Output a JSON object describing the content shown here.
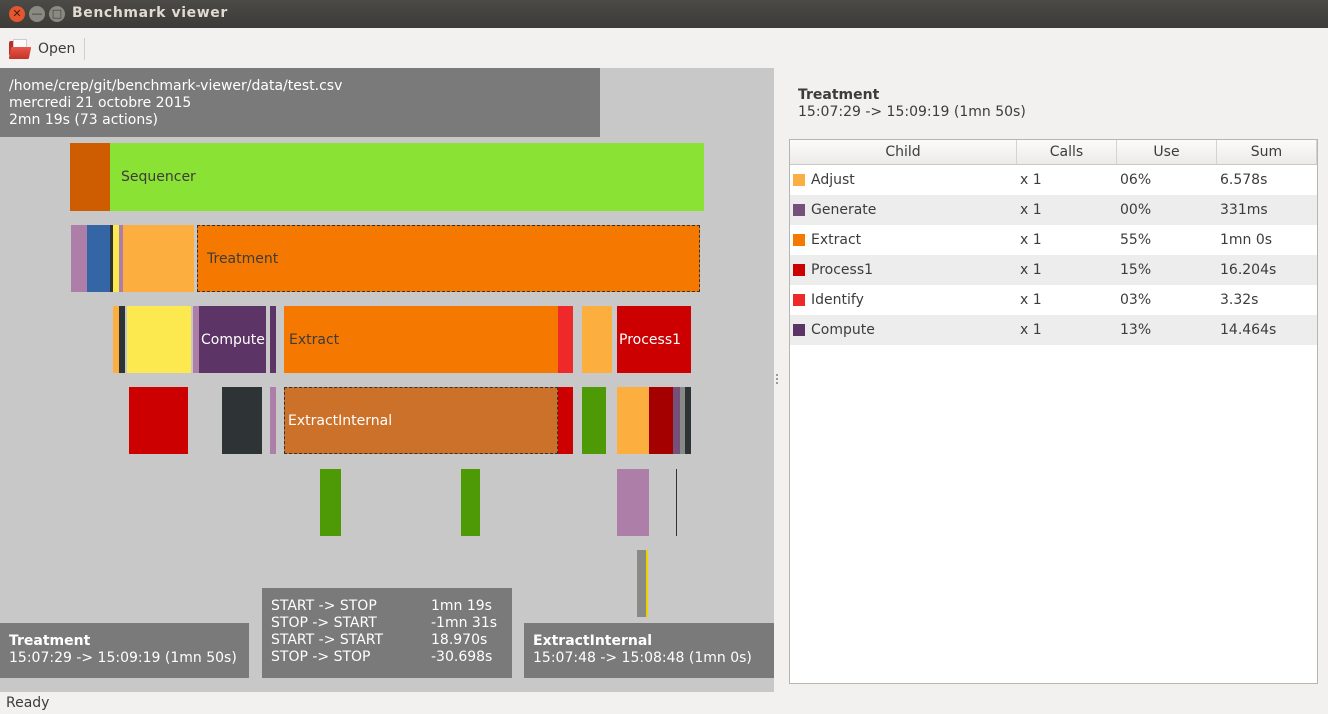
{
  "window": {
    "title": "Benchmark viewer",
    "close_glyph": "✕",
    "min_glyph": "—",
    "max_glyph": "□"
  },
  "toolbar": {
    "open_label": "Open",
    "open_icon": "folder-open-icon"
  },
  "file_info": {
    "path": "/home/crep/git/benchmark-viewer/data/test.csv",
    "date": "mercredi 21 octobre 2015",
    "summary": "2mn 19s (73 actions)"
  },
  "block_labels": {
    "sequencer": "Sequencer",
    "treatment": "Treatment",
    "compute": "Compute",
    "extract": "Extract",
    "process1": "Process1",
    "extract_internal": "ExtractInternal"
  },
  "hover_info": {
    "name": "Treatment",
    "time": "15:07:29 -> 15:09:19 (1mn 50s)"
  },
  "stats": [
    {
      "label": "START -> STOP",
      "value": "1mn 19s"
    },
    {
      "label": "STOP  -> START",
      "value": "-1mn 31s"
    },
    {
      "label": "START -> START",
      "value": "18.970s"
    },
    {
      "label": "STOP  -> STOP",
      "value": "-30.698s"
    }
  ],
  "selected_info": {
    "name": "ExtractInternal",
    "time": "15:07:48 -> 15:08:48 (1mn 0s)"
  },
  "detail": {
    "name": "Treatment",
    "time": "15:07:29 -> 15:09:19 (1mn 50s)",
    "columns": [
      "Child",
      "Calls",
      "Use",
      "Sum"
    ],
    "rows": [
      {
        "child": "Adjust",
        "color": "#fbae42",
        "calls": "x 1",
        "use": "06%",
        "sum": "6.578s"
      },
      {
        "child": "Generate",
        "color": "#75507b",
        "calls": "x 1",
        "use": "00%",
        "sum": "331ms"
      },
      {
        "child": "Extract",
        "color": "#f57900",
        "calls": "x 1",
        "use": "55%",
        "sum": "1mn 0s"
      },
      {
        "child": "Process1",
        "color": "#cc0000",
        "calls": "x 1",
        "use": "15%",
        "sum": "16.204s"
      },
      {
        "child": "Identify",
        "color": "#ef2929",
        "calls": "x 1",
        "use": "03%",
        "sum": "3.32s"
      },
      {
        "child": "Compute",
        "color": "#5c3566",
        "calls": "x 1",
        "use": "13%",
        "sum": "14.464s"
      }
    ]
  },
  "status": {
    "text": "Ready"
  }
}
